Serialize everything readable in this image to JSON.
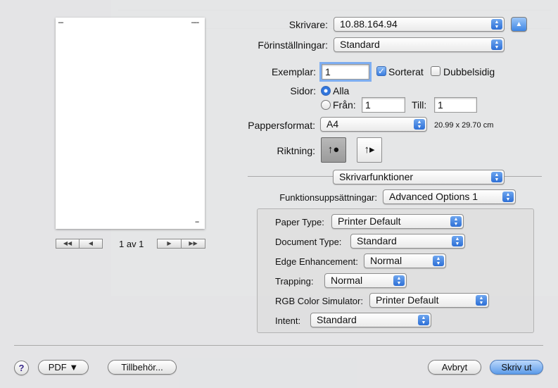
{
  "printer": {
    "label": "Skrivare:",
    "value": "10.88.164.94"
  },
  "presets": {
    "label": "Förinställningar:",
    "value": "Standard"
  },
  "copies": {
    "label": "Exemplar:",
    "value": "1",
    "collated_label": "Sorterat",
    "collated": true,
    "duplex_label": "Dubbelsidig",
    "duplex": false
  },
  "pages": {
    "label": "Sidor:",
    "all_label": "Alla",
    "from_label": "Från:",
    "from_value": "1",
    "to_label": "Till:",
    "to_value": "1"
  },
  "paper": {
    "label": "Pappersformat:",
    "value": "A4",
    "dimensions": "20.99 x 29.70 cm"
  },
  "orientation": {
    "label": "Riktning:"
  },
  "section": {
    "value": "Skrivarfunktioner"
  },
  "feature_set": {
    "label": "Funktionsuppsättningar:",
    "value": "Advanced Options 1"
  },
  "options": [
    {
      "label": "Paper Type:",
      "value": "Printer Default"
    },
    {
      "label": "Document Type:",
      "value": "Standard"
    },
    {
      "label": "Edge Enhancement:",
      "value": "Normal"
    },
    {
      "label": "Trapping:",
      "value": "Normal"
    },
    {
      "label": "RGB Color Simulator:",
      "value": "Printer Default"
    },
    {
      "label": "Intent:",
      "value": "Standard"
    }
  ],
  "preview": {
    "page_count": "1 av 1"
  },
  "footer": {
    "help": "?",
    "pdf": "PDF ▼",
    "supplies": "Tillbehör...",
    "cancel": "Avbryt",
    "print": "Skriv ut"
  },
  "colors": {
    "accent": "#3a7de0",
    "default_button": "#5c9be9"
  }
}
